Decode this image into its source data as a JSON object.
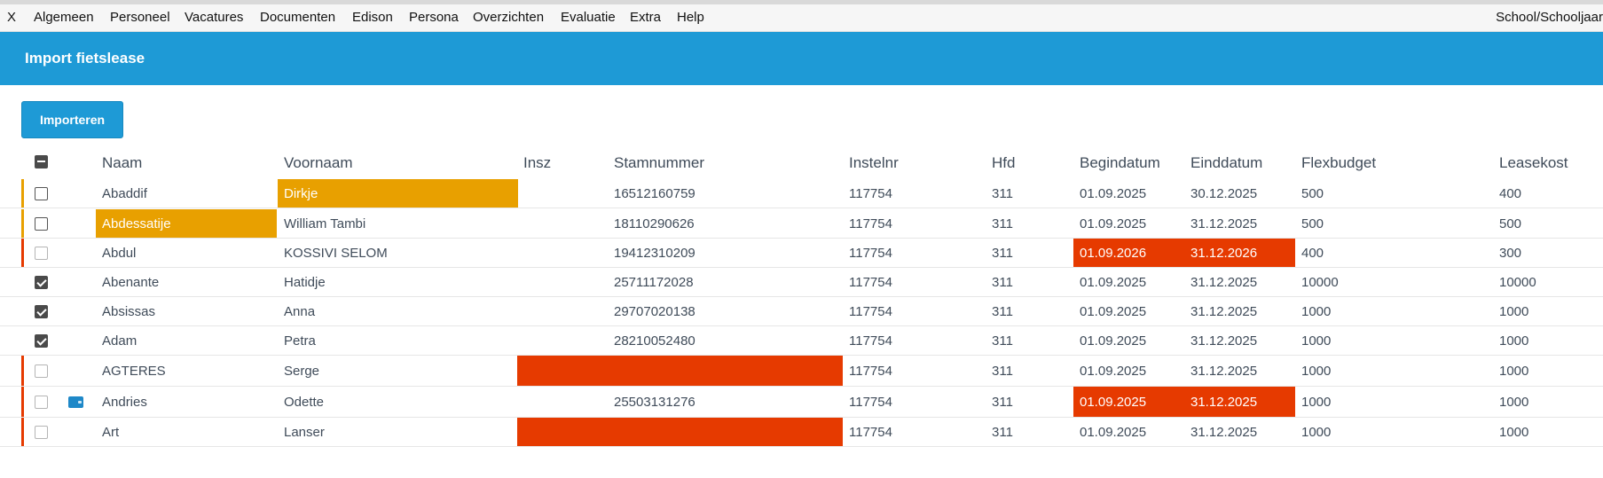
{
  "menu": {
    "items": [
      "X",
      "Algemeen",
      "Personeel",
      "Vacatures",
      "Documenten",
      "Edison",
      "Persona",
      "Overzichten",
      "Evaluatie",
      "Extra",
      "Help"
    ],
    "right_label": "School/Schooljaar"
  },
  "page": {
    "title": "Import fietslease"
  },
  "toolbar": {
    "import_label": "Importeren"
  },
  "table": {
    "columns": [
      "Naam",
      "Voornaam",
      "Insz",
      "Stamnummer",
      "Instelnr",
      "Hfd",
      "Begindatum",
      "Einddatum",
      "Flexbudget",
      "Leasekost"
    ],
    "rows": [
      {
        "naam": "Abaddif",
        "voornaam": "Dirkje",
        "insz": "",
        "stamnummer": "16512160759",
        "instelnr": "117754",
        "hfd": "311",
        "begindatum": "01.09.2025",
        "einddatum": "30.12.2025",
        "flexbudget": "500",
        "leasekost": "400",
        "checked": false,
        "status": "warning",
        "highlight": [
          "voornaam"
        ],
        "icon": ""
      },
      {
        "naam": "Abdessatije",
        "voornaam": "William Tambi",
        "insz": "",
        "stamnummer": "18110290626",
        "instelnr": "117754",
        "hfd": "311",
        "begindatum": "01.09.2025",
        "einddatum": "31.12.2025",
        "flexbudget": "500",
        "leasekost": "500",
        "checked": false,
        "status": "warning",
        "highlight": [
          "naam"
        ],
        "icon": ""
      },
      {
        "naam": "Abdul",
        "voornaam": "KOSSIVI SELOM",
        "insz": "",
        "stamnummer": "19412310209",
        "instelnr": "117754",
        "hfd": "311",
        "begindatum": "01.09.2026",
        "einddatum": "31.12.2026",
        "flexbudget": "400",
        "leasekost": "300",
        "checked": false,
        "status": "error",
        "highlight": [
          "begindatum",
          "einddatum"
        ],
        "icon": ""
      },
      {
        "naam": "Abenante",
        "voornaam": "Hatidje",
        "insz": "",
        "stamnummer": "25711172028",
        "instelnr": "117754",
        "hfd": "311",
        "begindatum": "01.09.2025",
        "einddatum": "31.12.2025",
        "flexbudget": "10000",
        "leasekost": "10000",
        "checked": true,
        "status": "ok",
        "highlight": [],
        "icon": ""
      },
      {
        "naam": "Absissas",
        "voornaam": "Anna",
        "insz": "",
        "stamnummer": "29707020138",
        "instelnr": "117754",
        "hfd": "311",
        "begindatum": "01.09.2025",
        "einddatum": "31.12.2025",
        "flexbudget": "1000",
        "leasekost": "1000",
        "checked": true,
        "status": "ok",
        "highlight": [],
        "icon": ""
      },
      {
        "naam": "Adam",
        "voornaam": "Petra",
        "insz": "",
        "stamnummer": "28210052480",
        "instelnr": "117754",
        "hfd": "311",
        "begindatum": "01.09.2025",
        "einddatum": "31.12.2025",
        "flexbudget": "1000",
        "leasekost": "1000",
        "checked": true,
        "status": "ok",
        "highlight": [],
        "icon": ""
      },
      {
        "naam": "AGTERES",
        "voornaam": "Serge",
        "insz": "",
        "stamnummer": "",
        "instelnr": "117754",
        "hfd": "311",
        "begindatum": "01.09.2025",
        "einddatum": "31.12.2025",
        "flexbudget": "1000",
        "leasekost": "1000",
        "checked": false,
        "status": "error",
        "highlight": [
          "insz_stam"
        ],
        "icon": ""
      },
      {
        "naam": "Andries",
        "voornaam": "Odette",
        "insz": "",
        "stamnummer": "25503131276",
        "instelnr": "117754",
        "hfd": "311",
        "begindatum": "01.09.2025",
        "einddatum": "31.12.2025",
        "flexbudget": "1000",
        "leasekost": "1000",
        "checked": false,
        "status": "error",
        "highlight": [
          "begindatum",
          "einddatum"
        ],
        "icon": "wallet-icon"
      },
      {
        "naam": "Art",
        "voornaam": "Lanser",
        "insz": "",
        "stamnummer": "",
        "instelnr": "117754",
        "hfd": "311",
        "begindatum": "01.09.2025",
        "einddatum": "31.12.2025",
        "flexbudget": "1000",
        "leasekost": "1000",
        "checked": false,
        "status": "error",
        "highlight": [
          "insz_stam"
        ],
        "icon": ""
      }
    ]
  },
  "colors": {
    "accent": "#1e9ad6",
    "warning": "#e8a000",
    "error": "#e63a00"
  }
}
